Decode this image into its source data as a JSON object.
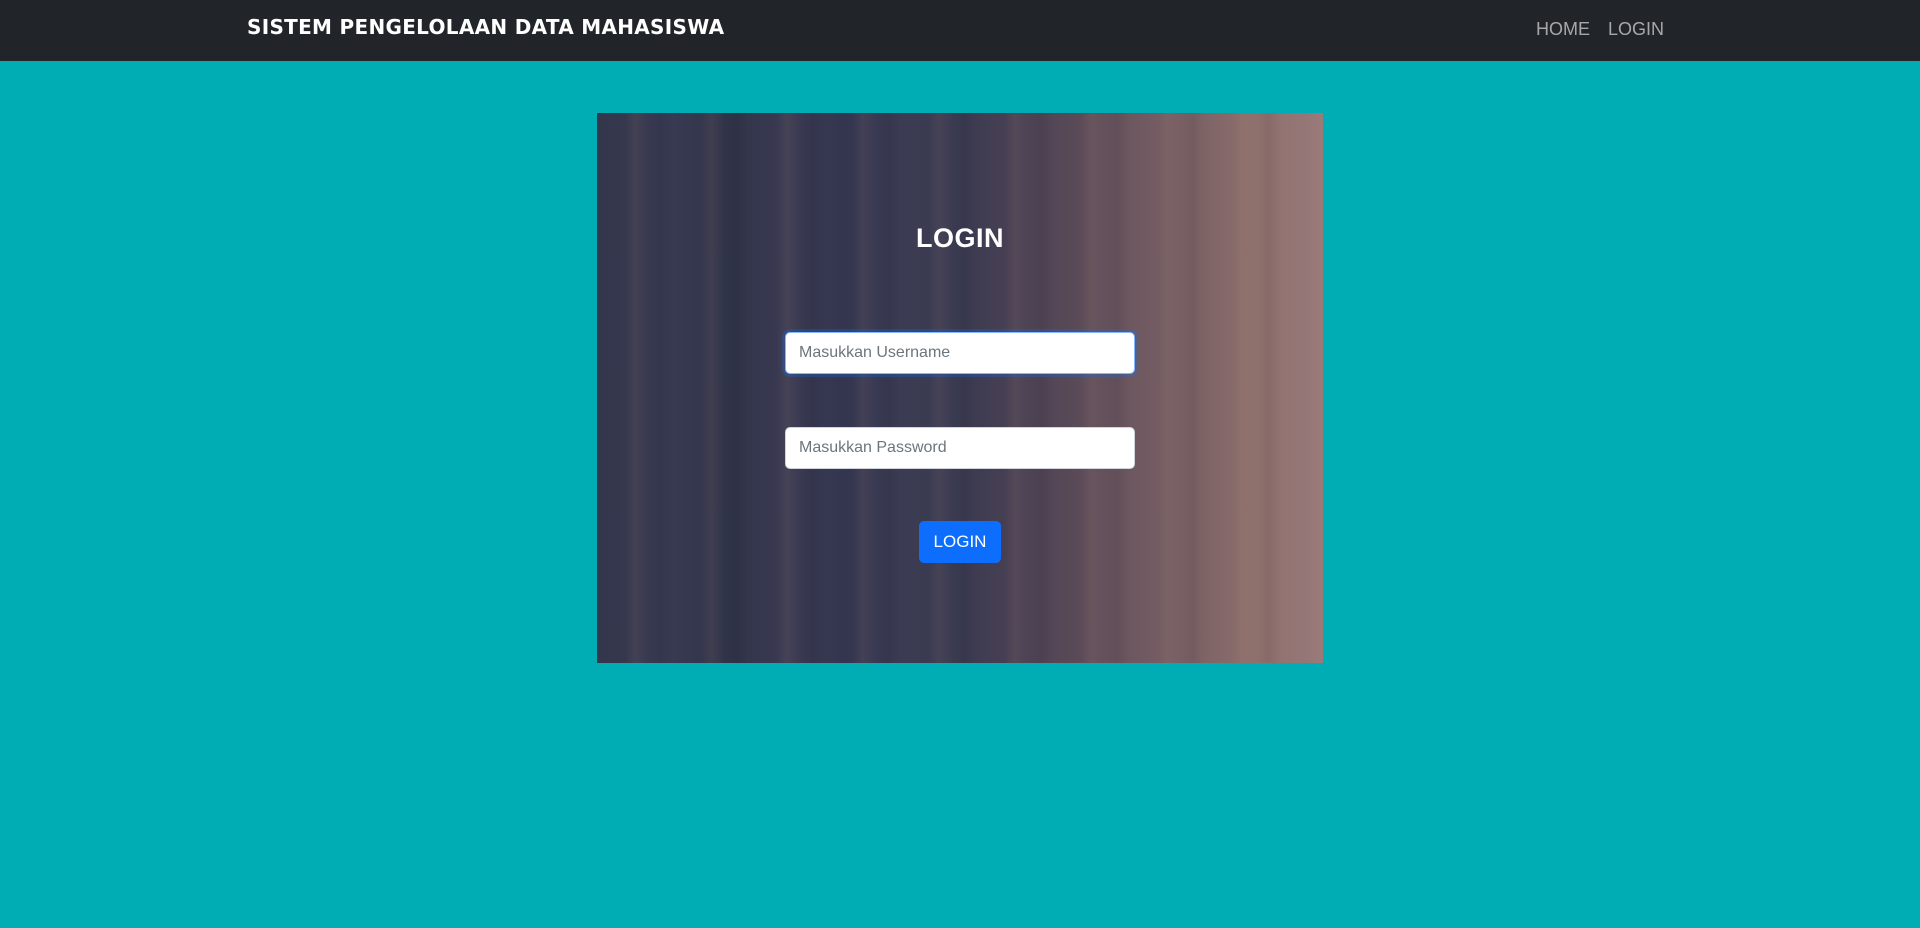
{
  "navbar": {
    "brand": "SISTEM PENGELOLAAN DATA MAHASISWA",
    "links": [
      {
        "label": "HOME"
      },
      {
        "label": "LOGIN"
      }
    ]
  },
  "login": {
    "title": "LOGIN",
    "username": {
      "placeholder": "Masukkan Username",
      "value": ""
    },
    "password": {
      "placeholder": "Masukkan Password",
      "value": ""
    },
    "submit_label": "LOGIN"
  },
  "colors": {
    "page_background": "#00adb5",
    "navbar_background": "#212529",
    "button_primary": "#0d6efd"
  }
}
